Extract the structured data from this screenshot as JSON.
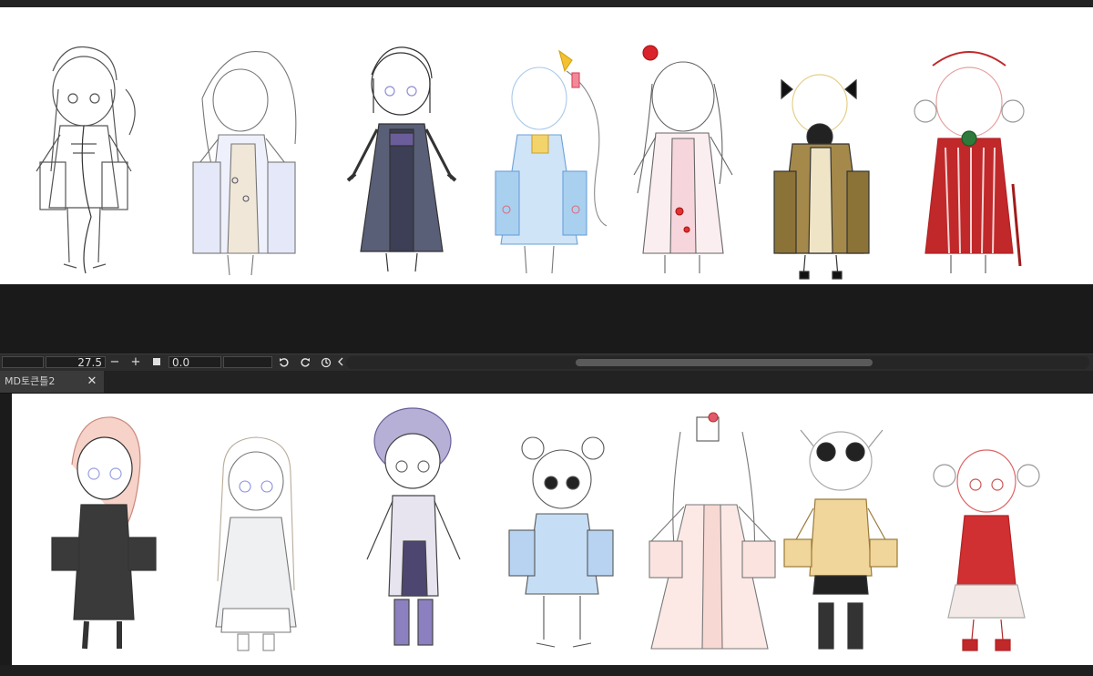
{
  "toolbar": {
    "zoom_value": "27.5",
    "zoom_minus": "−",
    "zoom_plus": "+",
    "rotation_value": "0.0"
  },
  "tab": {
    "label": "MD토큰틀2",
    "close": "✕"
  },
  "colors": {
    "app_bg": "#1b1b1b",
    "panel": "#2c2c2c",
    "canvas": "#ffffff",
    "accent_red": "#c0282a",
    "navy": "#3c3f55"
  },
  "icons": [
    "rotate-left-icon",
    "rotate-right-icon",
    "reset-rotation-icon",
    "collapse-arrow-icon",
    "close-icon",
    "fill-square-icon"
  ]
}
